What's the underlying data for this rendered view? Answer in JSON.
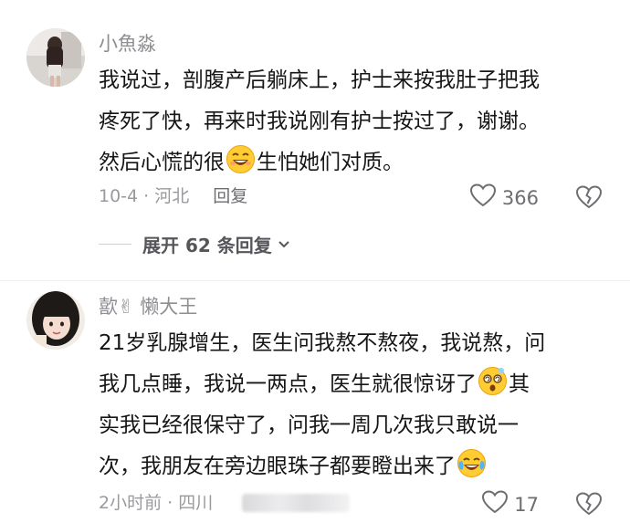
{
  "comments": [
    {
      "username": "小魚淼",
      "lines": [
        [
          "我说过，剖腹产后躺床上，护士来按我肚子把我",
          "",
          ""
        ],
        [
          "疼死了快，再来时我说刚有护士按过了，谢谢。",
          "",
          ""
        ],
        [
          "然后心慌的很",
          "grinning-sweat-emoji",
          "生怕她们对质。"
        ]
      ],
      "date_location": "10-4 · 河北",
      "reply_label": "回复",
      "like_count": "366",
      "expand_label": "展开 62 条回复"
    },
    {
      "username": "歖✌ 懒大王",
      "lines": [
        [
          "21岁乳腺增生，医生问我熬不熬夜，我说熬，问",
          "",
          ""
        ],
        [
          "我几点睡，我说一两点，医生就很惊讶了",
          "dizzy-face-emoji",
          "其"
        ],
        [
          "实我已经很保守了，问我一周几次我只敢说一",
          "",
          ""
        ],
        [
          "次，我朋友在旁边眼珠子都要瞪出来了",
          "tears-of-joy-emoji",
          ""
        ]
      ],
      "date_location": "2小时前 · 四川",
      "like_count": "17"
    }
  ],
  "colors": {
    "text": "#161616",
    "meta": "#9a9a9e",
    "username": "#8e8e93"
  }
}
